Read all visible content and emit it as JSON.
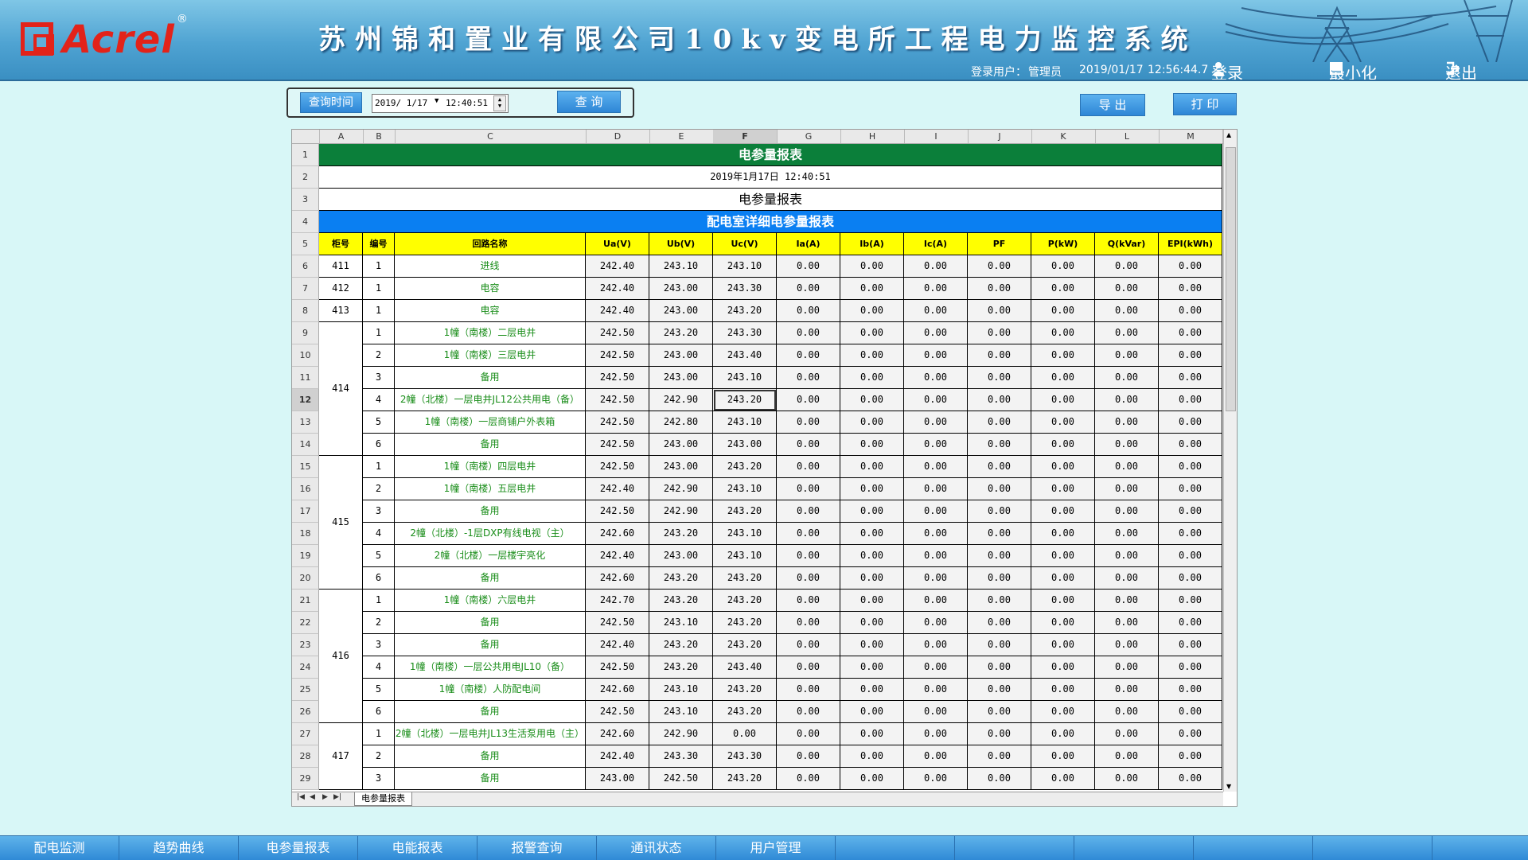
{
  "header": {
    "logo_text": "Acrel",
    "logo_reg": "®",
    "title": "苏州锦和置业有限公司10kv变电所工程电力监控系统",
    "user_label": "登录用户：",
    "user_name": "管理员",
    "date": "2019/01/17",
    "time": "12:56:44.7",
    "login": "登录",
    "minimize": "最小化",
    "logout": "退出"
  },
  "query": {
    "time_label": "查询时间",
    "date_value": "2019/ 1/17",
    "time_value": "12:40:51",
    "query_button": "查 询",
    "export_button": "导 出",
    "print_button": "打 印"
  },
  "sheet": {
    "columns": [
      "A",
      "B",
      "C",
      "D",
      "E",
      "F",
      "G",
      "H",
      "I",
      "J",
      "K",
      "L",
      "M"
    ],
    "selected_column": "F",
    "selected_row": 12,
    "title1": "电参量报表",
    "title2": "2019年1月17日 12:40:51",
    "title3": "电参量报表",
    "title4": "配电室详细电参量报表",
    "headers": [
      "柜号",
      "编号",
      "回路名称",
      "Ua(V)",
      "Ub(V)",
      "Uc(V)",
      "Ia(A)",
      "Ib(A)",
      "Ic(A)",
      "PF",
      "P(kW)",
      "Q(kVar)",
      "EPI(kWh)"
    ],
    "rows": [
      [
        "411",
        "1",
        "进线",
        "242.40",
        "243.10",
        "243.10",
        "0.00",
        "0.00",
        "0.00",
        "0.00",
        "0.00",
        "0.00",
        "0.00"
      ],
      [
        "412",
        "1",
        "电容",
        "242.40",
        "243.00",
        "243.30",
        "0.00",
        "0.00",
        "0.00",
        "0.00",
        "0.00",
        "0.00",
        "0.00"
      ],
      [
        "413",
        "1",
        "电容",
        "242.40",
        "243.00",
        "243.20",
        "0.00",
        "0.00",
        "0.00",
        "0.00",
        "0.00",
        "0.00",
        "0.00"
      ],
      [
        "414",
        "1",
        "1幢（南楼）二层电井",
        "242.50",
        "243.20",
        "243.30",
        "0.00",
        "0.00",
        "0.00",
        "0.00",
        "0.00",
        "0.00",
        "0.00"
      ],
      [
        "",
        "2",
        "1幢（南楼）三层电井",
        "242.50",
        "243.00",
        "243.40",
        "0.00",
        "0.00",
        "0.00",
        "0.00",
        "0.00",
        "0.00",
        "0.00"
      ],
      [
        "",
        "3",
        "备用",
        "242.50",
        "243.00",
        "243.10",
        "0.00",
        "0.00",
        "0.00",
        "0.00",
        "0.00",
        "0.00",
        "0.00"
      ],
      [
        "",
        "4",
        "2幢（北楼）一层电井JL12公共用电（备）",
        "242.50",
        "242.90",
        "243.20",
        "0.00",
        "0.00",
        "0.00",
        "0.00",
        "0.00",
        "0.00",
        "0.00"
      ],
      [
        "",
        "5",
        "1幢（南楼）一层商铺户外表箱",
        "242.50",
        "242.80",
        "243.10",
        "0.00",
        "0.00",
        "0.00",
        "0.00",
        "0.00",
        "0.00",
        "0.00"
      ],
      [
        "",
        "6",
        "备用",
        "242.50",
        "243.00",
        "243.00",
        "0.00",
        "0.00",
        "0.00",
        "0.00",
        "0.00",
        "0.00",
        "0.00"
      ],
      [
        "415",
        "1",
        "1幢（南楼）四层电井",
        "242.50",
        "243.00",
        "243.20",
        "0.00",
        "0.00",
        "0.00",
        "0.00",
        "0.00",
        "0.00",
        "0.00"
      ],
      [
        "",
        "2",
        "1幢（南楼）五层电井",
        "242.40",
        "242.90",
        "243.10",
        "0.00",
        "0.00",
        "0.00",
        "0.00",
        "0.00",
        "0.00",
        "0.00"
      ],
      [
        "",
        "3",
        "备用",
        "242.50",
        "242.90",
        "243.20",
        "0.00",
        "0.00",
        "0.00",
        "0.00",
        "0.00",
        "0.00",
        "0.00"
      ],
      [
        "",
        "4",
        "2幢（北楼）-1层DXP有线电视（主）",
        "242.60",
        "243.20",
        "243.10",
        "0.00",
        "0.00",
        "0.00",
        "0.00",
        "0.00",
        "0.00",
        "0.00"
      ],
      [
        "",
        "5",
        "2幢（北楼）一层楼宇亮化",
        "242.40",
        "243.00",
        "243.10",
        "0.00",
        "0.00",
        "0.00",
        "0.00",
        "0.00",
        "0.00",
        "0.00"
      ],
      [
        "",
        "6",
        "备用",
        "242.60",
        "243.20",
        "243.20",
        "0.00",
        "0.00",
        "0.00",
        "0.00",
        "0.00",
        "0.00",
        "0.00"
      ],
      [
        "416",
        "1",
        "1幢（南楼）六层电井",
        "242.70",
        "243.20",
        "243.20",
        "0.00",
        "0.00",
        "0.00",
        "0.00",
        "0.00",
        "0.00",
        "0.00"
      ],
      [
        "",
        "2",
        "备用",
        "242.50",
        "243.10",
        "243.20",
        "0.00",
        "0.00",
        "0.00",
        "0.00",
        "0.00",
        "0.00",
        "0.00"
      ],
      [
        "",
        "3",
        "备用",
        "242.40",
        "243.20",
        "243.20",
        "0.00",
        "0.00",
        "0.00",
        "0.00",
        "0.00",
        "0.00",
        "0.00"
      ],
      [
        "",
        "4",
        "1幢（南楼）一层公共用电JL10（备）",
        "242.50",
        "243.20",
        "243.40",
        "0.00",
        "0.00",
        "0.00",
        "0.00",
        "0.00",
        "0.00",
        "0.00"
      ],
      [
        "",
        "5",
        "1幢（南楼）人防配电间",
        "242.60",
        "243.10",
        "243.20",
        "0.00",
        "0.00",
        "0.00",
        "0.00",
        "0.00",
        "0.00",
        "0.00"
      ],
      [
        "",
        "6",
        "备用",
        "242.50",
        "243.10",
        "243.20",
        "0.00",
        "0.00",
        "0.00",
        "0.00",
        "0.00",
        "0.00",
        "0.00"
      ],
      [
        "417",
        "1",
        "2幢（北楼）一层电井JL13生活泵用电（主）",
        "242.60",
        "242.90",
        "0.00",
        "0.00",
        "0.00",
        "0.00",
        "0.00",
        "0.00",
        "0.00",
        "0.00"
      ],
      [
        "",
        "2",
        "备用",
        "242.40",
        "243.30",
        "243.30",
        "0.00",
        "0.00",
        "0.00",
        "0.00",
        "0.00",
        "0.00",
        "0.00"
      ],
      [
        "",
        "3",
        "备用",
        "243.00",
        "242.50",
        "243.20",
        "0.00",
        "0.00",
        "0.00",
        "0.00",
        "0.00",
        "0.00",
        "0.00"
      ]
    ],
    "tab_name": "电参量报表"
  },
  "bottom_nav": [
    "配电监测",
    "趋势曲线",
    "电参量报表",
    "电能报表",
    "报警查询",
    "通讯状态",
    "用户管理",
    "",
    "",
    "",
    "",
    "",
    ""
  ]
}
